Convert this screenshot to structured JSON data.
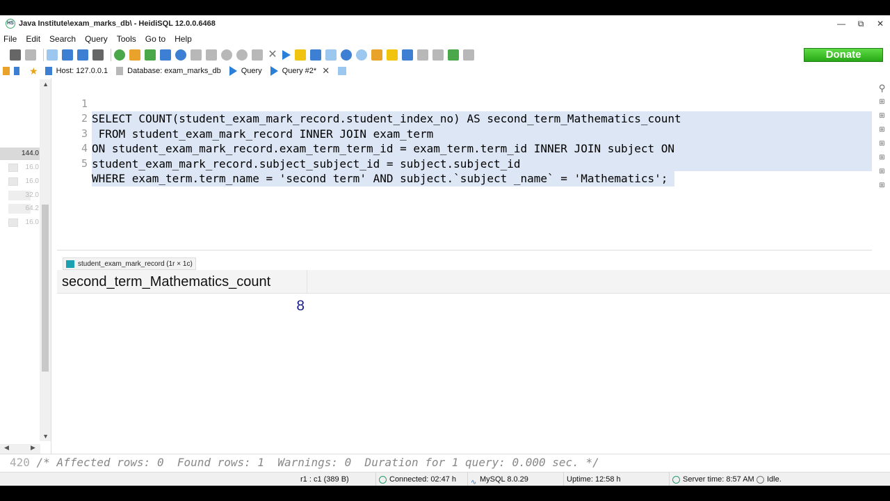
{
  "window": {
    "title": "Java Institute\\exam_marks_db\\ - HeidiSQL 12.0.0.6468",
    "app_icon": "heidisql-icon",
    "controls": [
      "minimize-icon",
      "restore-icon",
      "close-icon"
    ]
  },
  "menu": [
    "File",
    "Edit",
    "Search",
    "Query",
    "Tools",
    "Go to",
    "Help"
  ],
  "donate_label": "Donate",
  "tabs": {
    "host": "Host: 127.0.0.1",
    "database": "Database: exam_marks_db",
    "query": "Query",
    "query2": "Query #2*"
  },
  "left_panel": {
    "selected_size": "144.0",
    "sizes": [
      "16.0",
      "16.0",
      "32.0",
      "64.2",
      "16.0"
    ]
  },
  "editor": {
    "line_numbers": [
      "1",
      "2",
      "3",
      "4",
      "5"
    ],
    "lines": [
      "SELECT COUNT(student_exam_mark_record.student_index_no) AS second_term_Mathematics_count",
      " FROM student_exam_mark_record INNER JOIN exam_term",
      "ON student_exam_mark_record.exam_term_term_id = exam_term.term_id INNER JOIN subject ON",
      "student_exam_mark_record.subject_subject_id = subject.subject_id",
      "WHERE exam_term.term_name = 'second term' AND subject.`subject _name` = 'Mathematics';"
    ]
  },
  "results": {
    "tab_label": "student_exam_mark_record (1r × 1c)",
    "column": "second_term_Mathematics_count",
    "value": "8"
  },
  "log": {
    "line_no": "420",
    "text": "/* Affected rows: 0  Found rows: 1  Warnings: 0  Duration for 1 query: 0.000 sec. */"
  },
  "status": {
    "cursor": "r1 : c1 (389 B)",
    "connected": "Connected: 02:47 h",
    "server": "MySQL 8.0.29",
    "uptime": "Uptime: 12:58 h",
    "server_time": "Server time: 8:57 AM",
    "state": "Idle."
  }
}
